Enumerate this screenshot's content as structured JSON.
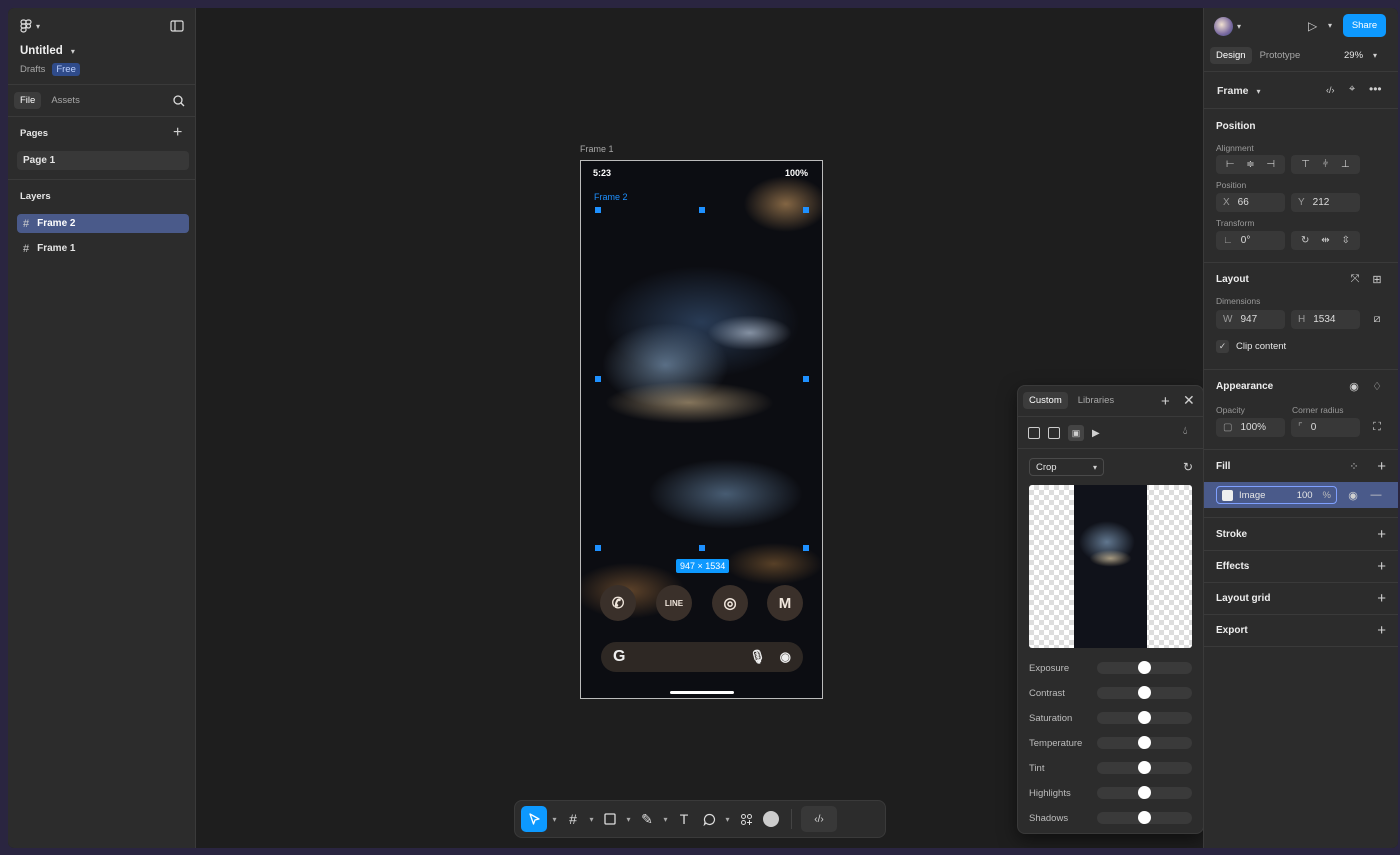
{
  "file": {
    "title": "Untitled",
    "location": "Drafts",
    "plan": "Free"
  },
  "left_tabs": {
    "file": "File",
    "assets": "Assets"
  },
  "pages": {
    "heading": "Pages",
    "items": [
      "Page 1"
    ]
  },
  "layers": {
    "heading": "Layers",
    "items": [
      "Frame 2",
      "Frame 1"
    ]
  },
  "canvas": {
    "frame_label": "Frame 1",
    "inner_frame_label": "Frame 2",
    "size_badge": "947 × 1534",
    "status_time": "5:23",
    "status_battery": "100%",
    "dock_line_label": "LINE"
  },
  "right": {
    "tabs": {
      "design": "Design",
      "prototype": "Prototype"
    },
    "zoom": "29%",
    "share_label": "Share",
    "selection_type": "Frame",
    "position": {
      "heading": "Position",
      "alignment_label": "Alignment",
      "position_label": "Position",
      "x_label": "X",
      "x": "66",
      "y_label": "Y",
      "y": "212",
      "transform_label": "Transform",
      "rotation": "0°"
    },
    "layout": {
      "heading": "Layout",
      "dimensions_label": "Dimensions",
      "w_label": "W",
      "w": "947",
      "h_label": "H",
      "h": "1534",
      "clip_content": "Clip content"
    },
    "appearance": {
      "heading": "Appearance",
      "opacity_label": "Opacity",
      "opacity": "100%",
      "radius_label": "Corner radius",
      "radius": "0"
    },
    "fill": {
      "heading": "Fill",
      "type": "Image",
      "opacity": "100",
      "unit": "%"
    },
    "stroke": "Stroke",
    "effects": "Effects",
    "layout_grid": "Layout grid",
    "export": "Export"
  },
  "popup": {
    "tabs": {
      "custom": "Custom",
      "libraries": "Libraries"
    },
    "mode": "Crop",
    "adjustments": [
      {
        "label": "Exposure",
        "value": 0.5
      },
      {
        "label": "Contrast",
        "value": 0.5
      },
      {
        "label": "Saturation",
        "value": 0.5
      },
      {
        "label": "Temperature",
        "value": 0.5
      },
      {
        "label": "Tint",
        "value": 0.5
      },
      {
        "label": "Highlights",
        "value": 0.5
      },
      {
        "label": "Shadows",
        "value": 0.5
      }
    ]
  },
  "help": "?",
  "colors": {
    "accent": "#0d99ff",
    "selection": "#4a5a8a",
    "canvas": "#1e1e1e",
    "panel": "#2c2c2c"
  }
}
